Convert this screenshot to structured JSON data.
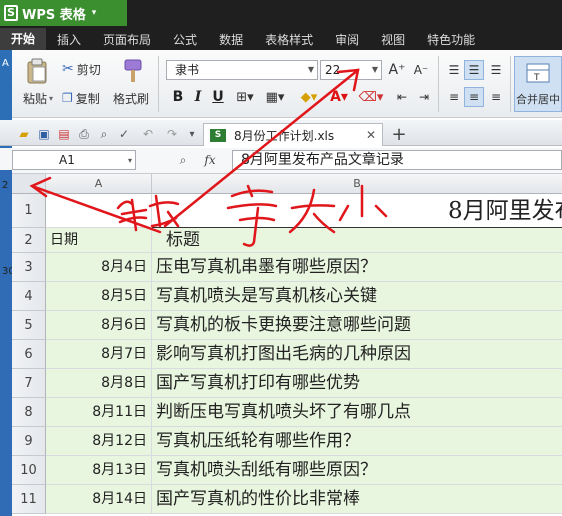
{
  "app": {
    "title": "WPS 表格"
  },
  "menu": [
    "开始",
    "插入",
    "页面布局",
    "公式",
    "数据",
    "表格样式",
    "审阅",
    "视图",
    "特色功能"
  ],
  "ribbon": {
    "paste": "粘贴",
    "cut": "剪切",
    "copy": "复制",
    "format_painter": "格式刷",
    "font_name": "隶书",
    "font_size": "22",
    "bold": "B",
    "italic": "I",
    "underline": "U",
    "merge_center": "合并居中"
  },
  "tab": {
    "file_name": "8月份工作计划.xls"
  },
  "formula": {
    "cell_ref": "A1",
    "fx": "fx",
    "content": "8月阿里发布产品文章记录"
  },
  "columns": [
    "A",
    "B"
  ],
  "rows": [
    {
      "n": "1",
      "a": "",
      "b": "8月阿里发布产品文章记录"
    },
    {
      "n": "2",
      "a": "日期",
      "b": "标题"
    },
    {
      "n": "3",
      "a": "8月4日",
      "b": "压电写真机串墨有哪些原因？"
    },
    {
      "n": "4",
      "a": "8月5日",
      "b": "写真机喷头是写真机核心关键"
    },
    {
      "n": "5",
      "a": "8月6日",
      "b": "写真机的板卡更换要注意哪些问题"
    },
    {
      "n": "6",
      "a": "8月7日",
      "b": "影响写真机打图出毛病的几种原因"
    },
    {
      "n": "7",
      "a": "8月8日",
      "b": "国产写真机打印有哪些优势"
    },
    {
      "n": "8",
      "a": "8月11日",
      "b": "判断压电写真机喷头坏了有哪几点"
    },
    {
      "n": "9",
      "a": "8月12日",
      "b": "写真机压纸轮有哪些作用？"
    },
    {
      "n": "10",
      "a": "8月13日",
      "b": "写真机喷头刮纸有哪些原因？"
    },
    {
      "n": "11",
      "a": "8月14日",
      "b": "国产写真机的性价比非常棒"
    }
  ],
  "annotation": {
    "handwritten": "错字大小"
  },
  "colors": {
    "accent_green": "#3b8f2f",
    "row_highlight": "#e8f5df",
    "annotation_red": "#e0161b"
  }
}
